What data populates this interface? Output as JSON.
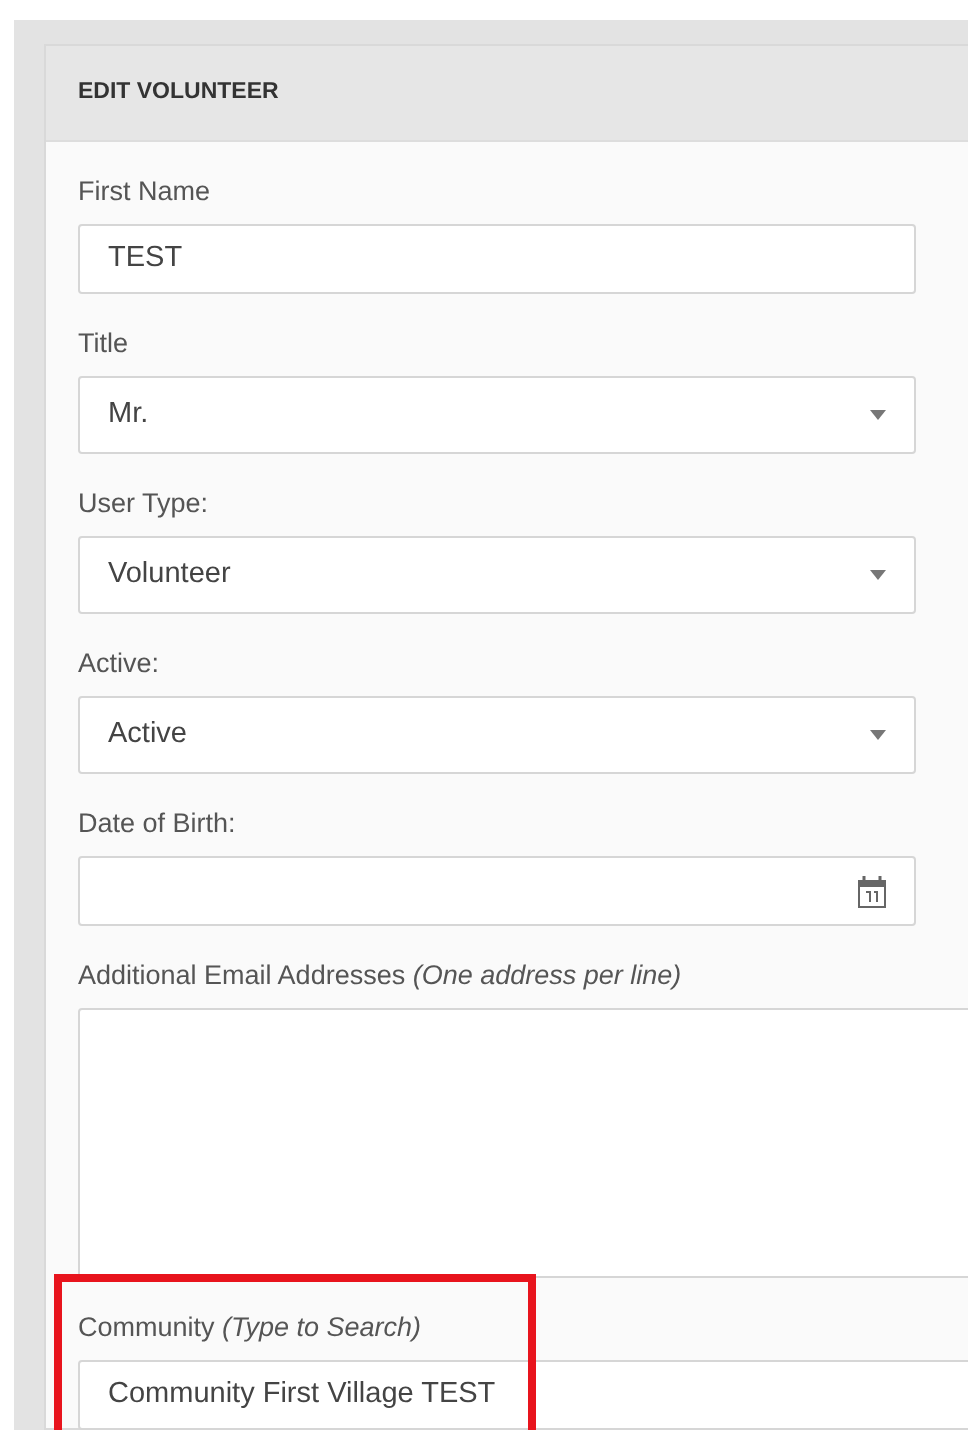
{
  "panel": {
    "title": "EDIT VOLUNTEER"
  },
  "fields": [
    {
      "kind": "text",
      "label": "First Name",
      "value": "TEST",
      "highlighted": false
    },
    {
      "kind": "select",
      "label": "Title",
      "value": "Mr.",
      "highlighted": false
    },
    {
      "kind": "select",
      "label": "User Type:",
      "value": "Volunteer",
      "highlighted": false
    },
    {
      "kind": "select",
      "label": "Active:",
      "value": "Active",
      "highlighted": false
    },
    {
      "kind": "date",
      "label": "Date of Birth:",
      "highlighted": false
    },
    {
      "kind": "textarea",
      "label": "Additional Email Addresses *(One address per line)*",
      "highlighted": false
    },
    {
      "kind": "search",
      "label": "Community *(Type to Search)*",
      "value": "Community First Village TEST",
      "highlighted": true
    }
  ]
}
